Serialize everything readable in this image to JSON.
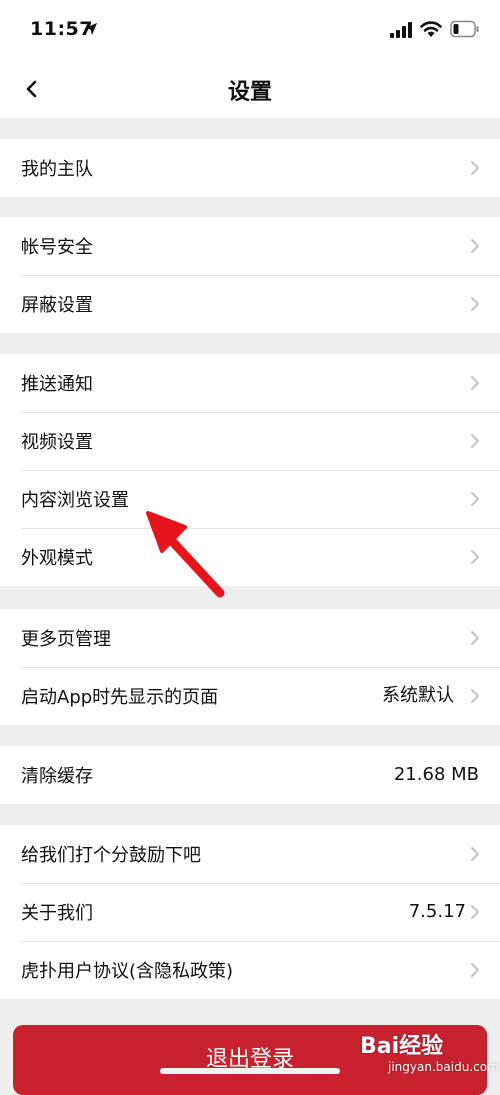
{
  "status_bar": {
    "time": "11:57"
  },
  "nav": {
    "title": "设置"
  },
  "groups": [
    {
      "items": [
        {
          "label": "我的主队"
        }
      ]
    },
    {
      "items": [
        {
          "label": "帐号安全"
        },
        {
          "label": "屏蔽设置"
        }
      ]
    },
    {
      "items": [
        {
          "label": "推送通知"
        },
        {
          "label": "视频设置"
        },
        {
          "label": "内容浏览设置"
        },
        {
          "label": "外观模式"
        }
      ]
    },
    {
      "items": [
        {
          "label": "更多页管理"
        },
        {
          "label": "启动App时先显示的页面",
          "value": "系统默认"
        }
      ]
    },
    {
      "items": [
        {
          "label": "清除缓存",
          "value": "21.68 MB"
        }
      ]
    },
    {
      "items": [
        {
          "label": "给我们打个分鼓励下吧"
        },
        {
          "label": "关于我们",
          "value": "7.5.17"
        },
        {
          "label": "虎扑用户协议(含隐私政策)"
        }
      ]
    }
  ],
  "logout": {
    "label": "退出登录"
  },
  "watermark": {
    "brand": "Bai经验",
    "sub": "jingyan.baidu.com"
  },
  "colors": {
    "accent": "#c8222f",
    "annotation": "#e8141c",
    "background": "#eeeeee"
  }
}
